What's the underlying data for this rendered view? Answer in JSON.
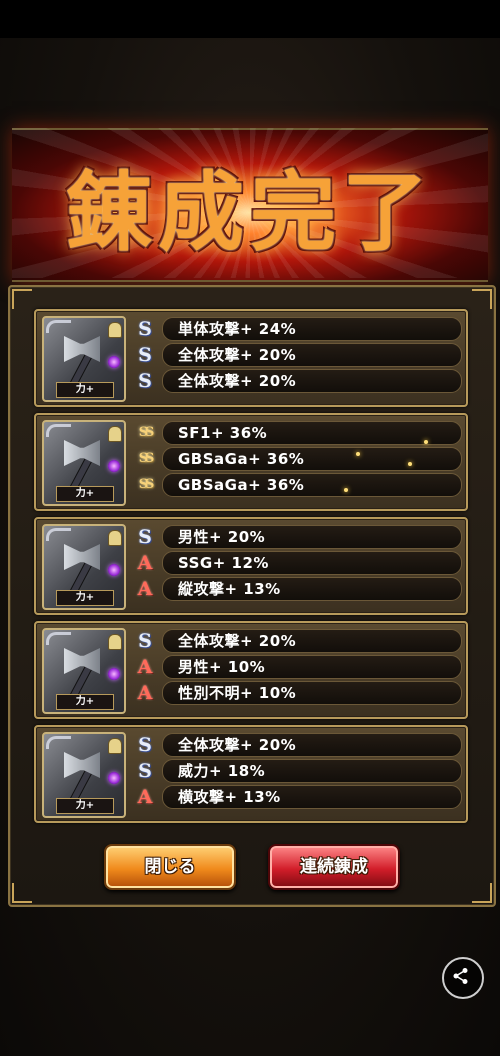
{
  "banner": {
    "title": "錬成完了"
  },
  "results": [
    {
      "item": {
        "tag": "力+",
        "icon": "axe-icon"
      },
      "abilities": [
        {
          "rank": "S",
          "text": "単体攻撃+ 24%"
        },
        {
          "rank": "S",
          "text": "全体攻撃+ 20%"
        },
        {
          "rank": "S",
          "text": "全体攻撃+ 20%"
        }
      ]
    },
    {
      "item": {
        "tag": "力+",
        "icon": "axe-icon"
      },
      "abilities": [
        {
          "rank": "SS",
          "text": "SF1+ 36%"
        },
        {
          "rank": "SS",
          "text": "GBSaGa+ 36%"
        },
        {
          "rank": "SS",
          "text": "GBSaGa+ 36%"
        }
      ]
    },
    {
      "item": {
        "tag": "力+",
        "icon": "axe-icon"
      },
      "abilities": [
        {
          "rank": "S",
          "text": "男性+ 20%"
        },
        {
          "rank": "A",
          "text": "SSG+ 12%"
        },
        {
          "rank": "A",
          "text": "縦攻撃+ 13%"
        }
      ]
    },
    {
      "item": {
        "tag": "力+",
        "icon": "axe-icon"
      },
      "abilities": [
        {
          "rank": "S",
          "text": "全体攻撃+ 20%"
        },
        {
          "rank": "A",
          "text": "男性+ 10%"
        },
        {
          "rank": "A",
          "text": "性別不明+ 10%"
        }
      ]
    },
    {
      "item": {
        "tag": "力+",
        "icon": "axe-icon"
      },
      "abilities": [
        {
          "rank": "S",
          "text": "全体攻撃+ 20%"
        },
        {
          "rank": "S",
          "text": "威力+ 18%"
        },
        {
          "rank": "A",
          "text": "横攻撃+ 13%"
        }
      ]
    }
  ],
  "buttons": {
    "close_label": "閉じる",
    "repeat_label": "連続錬成"
  },
  "colors": {
    "rank_S": "#e8eef8",
    "rank_SS": "#f7d27a",
    "rank_A": "#ff6a5a",
    "panel_border": "#8a7342"
  }
}
